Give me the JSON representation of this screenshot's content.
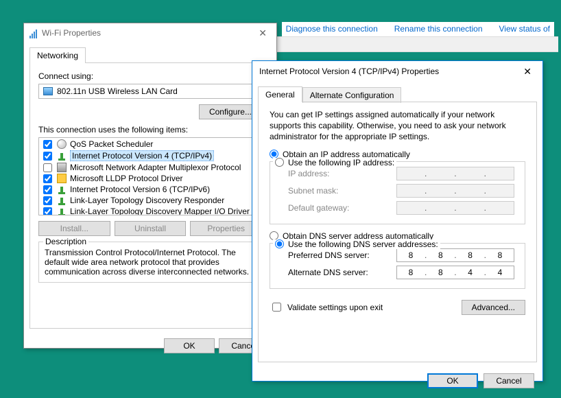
{
  "toplinks": {
    "diagnose": "Diagnose this connection",
    "rename": "Rename this connection",
    "viewstatus": "View status of"
  },
  "wifi": {
    "title": "Wi-Fi Properties",
    "tab_networking": "Networking",
    "connect_using": "Connect using:",
    "adapter": "802.11n USB Wireless LAN Card",
    "configure_btn": "Configure...",
    "items_label": "This connection uses the following items:",
    "items": [
      {
        "checked": true,
        "icon": "qos",
        "label": "QoS Packet Scheduler"
      },
      {
        "checked": true,
        "icon": "net",
        "label": "Internet Protocol Version 4 (TCP/IPv4)",
        "selected": true
      },
      {
        "checked": false,
        "icon": "adapter",
        "label": "Microsoft Network Adapter Multiplexor Protocol"
      },
      {
        "checked": true,
        "icon": "lldp",
        "label": "Microsoft LLDP Protocol Driver"
      },
      {
        "checked": true,
        "icon": "net",
        "label": "Internet Protocol Version 6 (TCP/IPv6)"
      },
      {
        "checked": true,
        "icon": "net",
        "label": "Link-Layer Topology Discovery Responder"
      },
      {
        "checked": true,
        "icon": "net",
        "label": "Link-Layer Topology Discovery Mapper I/O Driver"
      }
    ],
    "install_btn": "Install...",
    "uninstall_btn": "Uninstall",
    "properties_btn": "Properties",
    "desc_title": "Description",
    "desc_text": "Transmission Control Protocol/Internet Protocol. The default wide area network protocol that provides communication across diverse interconnected networks.",
    "ok": "OK",
    "cancel": "Cancel"
  },
  "tcp": {
    "title": "Internet Protocol Version 4 (TCP/IPv4) Properties",
    "tab_general": "General",
    "tab_alt": "Alternate Configuration",
    "explain": "You can get IP settings assigned automatically if your network supports this capability. Otherwise, you need to ask your network administrator for the appropriate IP settings.",
    "ip_auto": "Obtain an IP address automatically",
    "ip_manual": "Use the following IP address:",
    "ip_address_lbl": "IP address:",
    "subnet_lbl": "Subnet mask:",
    "gateway_lbl": "Default gateway:",
    "dns_auto": "Obtain DNS server address automatically",
    "dns_manual": "Use the following DNS server addresses:",
    "pref_dns_lbl": "Preferred DNS server:",
    "alt_dns_lbl": "Alternate DNS server:",
    "pref_dns": [
      "8",
      "8",
      "8",
      "8"
    ],
    "alt_dns": [
      "8",
      "8",
      "4",
      "4"
    ],
    "validate": "Validate settings upon exit",
    "advanced": "Advanced...",
    "ok": "OK",
    "cancel": "Cancel"
  }
}
